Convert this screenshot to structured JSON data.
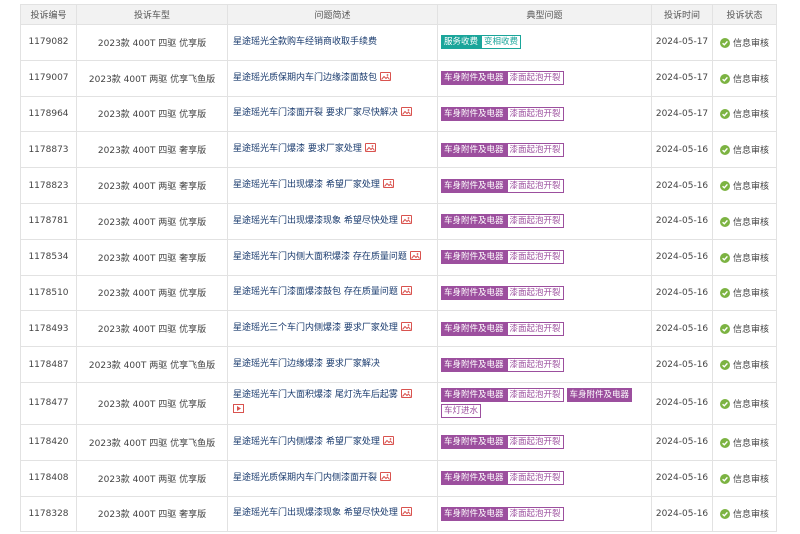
{
  "colors": {
    "teal": "#1aa59a",
    "purple": "#9c4f9e",
    "check_green": "#7cb342",
    "icon_red": "#d9534f"
  },
  "icons": {
    "image": "image-icon",
    "video": "video-icon",
    "status": "check-circle-icon"
  },
  "headers": [
    "投诉编号",
    "投诉车型",
    "问题简述",
    "典型问题",
    "投诉时间",
    "投诉状态"
  ],
  "rows": [
    {
      "id": "1179082",
      "model": "2023款 400T 四驱 优享版",
      "desc": "星途瑶光全款购车经销商收取手续费",
      "pic": false,
      "video": false,
      "tags": [
        {
          "text": "服务收费",
          "style": "teal-fill"
        },
        {
          "text": "变相收费",
          "style": "teal-outline"
        }
      ],
      "date": "2024-05-17",
      "status": "信息审核"
    },
    {
      "id": "1179007",
      "model": "2023款 400T 两驱 优享飞鱼版",
      "desc": "星途瑶光质保期内车门边缘漆面鼓包",
      "pic": true,
      "video": false,
      "tags": [
        {
          "text": "车身附件及电器",
          "style": "purple-fill"
        },
        {
          "text": "漆面起泡开裂",
          "style": "purple-outline"
        }
      ],
      "date": "2024-05-17",
      "status": "信息审核"
    },
    {
      "id": "1178964",
      "model": "2023款 400T 四驱 优享版",
      "desc": "星途瑶光车门漆面开裂 要求厂家尽快解决",
      "pic": true,
      "video": false,
      "tags": [
        {
          "text": "车身附件及电器",
          "style": "purple-fill"
        },
        {
          "text": "漆面起泡开裂",
          "style": "purple-outline"
        }
      ],
      "date": "2024-05-17",
      "status": "信息审核"
    },
    {
      "id": "1178873",
      "model": "2023款 400T 四驱 奢享版",
      "desc": "星途瑶光车门爆漆 要求厂家处理",
      "pic": true,
      "video": false,
      "tags": [
        {
          "text": "车身附件及电器",
          "style": "purple-fill"
        },
        {
          "text": "漆面起泡开裂",
          "style": "purple-outline"
        }
      ],
      "date": "2024-05-16",
      "status": "信息审核"
    },
    {
      "id": "1178823",
      "model": "2023款 400T 两驱 奢享版",
      "desc": "星途瑶光车门出现爆漆 希望厂家处理",
      "pic": true,
      "video": false,
      "tags": [
        {
          "text": "车身附件及电器",
          "style": "purple-fill"
        },
        {
          "text": "漆面起泡开裂",
          "style": "purple-outline"
        }
      ],
      "date": "2024-05-16",
      "status": "信息审核"
    },
    {
      "id": "1178781",
      "model": "2023款 400T 两驱 优享版",
      "desc": "星途瑶光车门出现爆漆现象 希望尽快处理",
      "pic": true,
      "video": false,
      "tags": [
        {
          "text": "车身附件及电器",
          "style": "purple-fill"
        },
        {
          "text": "漆面起泡开裂",
          "style": "purple-outline"
        }
      ],
      "date": "2024-05-16",
      "status": "信息审核"
    },
    {
      "id": "1178534",
      "model": "2023款 400T 四驱 奢享版",
      "desc": "星途瑶光车门内侧大面积爆漆 存在质量问题",
      "pic": true,
      "video": false,
      "tags": [
        {
          "text": "车身附件及电器",
          "style": "purple-fill"
        },
        {
          "text": "漆面起泡开裂",
          "style": "purple-outline"
        }
      ],
      "date": "2024-05-16",
      "status": "信息审核"
    },
    {
      "id": "1178510",
      "model": "2023款 400T 两驱 优享版",
      "desc": "星途瑶光车门漆面爆漆鼓包 存在质量问题",
      "pic": true,
      "video": false,
      "tags": [
        {
          "text": "车身附件及电器",
          "style": "purple-fill"
        },
        {
          "text": "漆面起泡开裂",
          "style": "purple-outline"
        }
      ],
      "date": "2024-05-16",
      "status": "信息审核"
    },
    {
      "id": "1178493",
      "model": "2023款 400T 四驱 优享版",
      "desc": "星途瑶光三个车门内侧爆漆 要求厂家处理",
      "pic": true,
      "video": false,
      "tags": [
        {
          "text": "车身附件及电器",
          "style": "purple-fill"
        },
        {
          "text": "漆面起泡开裂",
          "style": "purple-outline"
        }
      ],
      "date": "2024-05-16",
      "status": "信息审核"
    },
    {
      "id": "1178487",
      "model": "2023款 400T 两驱 优享飞鱼版",
      "desc": "星途瑶光车门边缘爆漆 要求厂家解决",
      "pic": false,
      "video": false,
      "tags": [
        {
          "text": "车身附件及电器",
          "style": "purple-fill"
        },
        {
          "text": "漆面起泡开裂",
          "style": "purple-outline"
        }
      ],
      "date": "2024-05-16",
      "status": "信息审核"
    },
    {
      "id": "1178477",
      "model": "2023款 400T 四驱 优享版",
      "desc": "星途瑶光车门大面积爆漆 尾灯洗车后起雾",
      "pic": true,
      "video": true,
      "tags": [
        {
          "text": "车身附件及电器",
          "style": "purple-fill"
        },
        {
          "text": "漆面起泡开裂",
          "style": "purple-outline"
        },
        {
          "text": "车身附件及电器",
          "style": "purple-fill"
        },
        {
          "text": "车灯进水",
          "style": "purple-outline"
        }
      ],
      "date": "2024-05-16",
      "status": "信息审核"
    },
    {
      "id": "1178420",
      "model": "2023款 400T 四驱 优享飞鱼版",
      "desc": "星途瑶光车门内侧爆漆 希望厂家处理",
      "pic": true,
      "video": false,
      "tags": [
        {
          "text": "车身附件及电器",
          "style": "purple-fill"
        },
        {
          "text": "漆面起泡开裂",
          "style": "purple-outline"
        }
      ],
      "date": "2024-05-16",
      "status": "信息审核"
    },
    {
      "id": "1178408",
      "model": "2023款 400T 两驱 优享版",
      "desc": "星途瑶光质保期内车门内侧漆面开裂",
      "pic": true,
      "video": false,
      "tags": [
        {
          "text": "车身附件及电器",
          "style": "purple-fill"
        },
        {
          "text": "漆面起泡开裂",
          "style": "purple-outline"
        }
      ],
      "date": "2024-05-16",
      "status": "信息审核"
    },
    {
      "id": "1178328",
      "model": "2023款 400T 四驱 奢享版",
      "desc": "星途瑶光车门出现爆漆现象 希望尽快处理",
      "pic": true,
      "video": false,
      "tags": [
        {
          "text": "车身附件及电器",
          "style": "purple-fill"
        },
        {
          "text": "漆面起泡开裂",
          "style": "purple-outline"
        }
      ],
      "date": "2024-05-16",
      "status": "信息审核"
    }
  ]
}
